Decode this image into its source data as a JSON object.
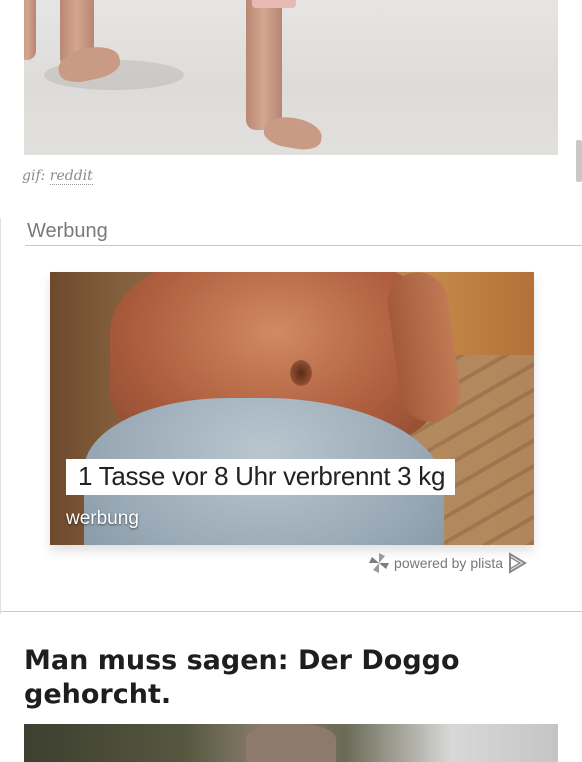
{
  "top_image": {
    "description_icon": "photo-feet-on-floor"
  },
  "caption": {
    "prefix": "gif:",
    "source": "reddit"
  },
  "ad": {
    "section_label": "Werbung",
    "headline": "1 Tasse vor 8 Uhr verbrennt 3 kg",
    "tag": "werbung",
    "powered_by": "powered by plista",
    "logo_icon": "plista-pinwheel-icon",
    "play_icon": "plista-play-icon"
  },
  "article": {
    "title": "Man muss sagen: Der Doggo gehorcht."
  },
  "colors": {
    "text_dark": "#1e1e1e",
    "text_muted": "#7a7a7a",
    "divider": "#c9c9c9"
  }
}
